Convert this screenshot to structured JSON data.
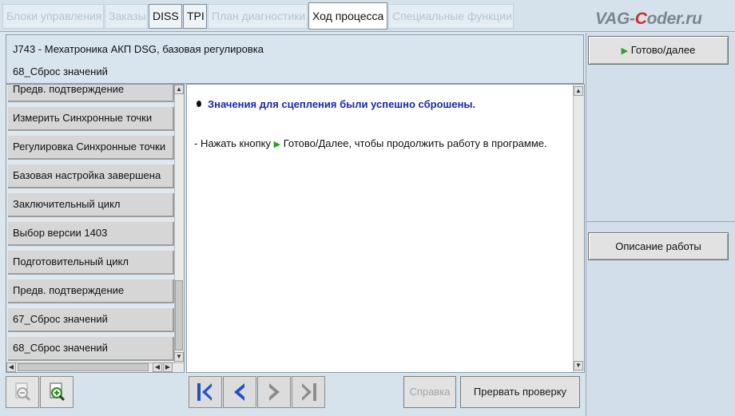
{
  "tabs": [
    {
      "label": "Блоки управления",
      "state": "disabled"
    },
    {
      "label": "Заказы",
      "state": "disabled"
    },
    {
      "label": "DISS",
      "state": "enabled"
    },
    {
      "label": "TPI",
      "state": "enabled"
    },
    {
      "label": "План диагностики",
      "state": "disabled"
    },
    {
      "label": "Ход процесса",
      "state": "active"
    },
    {
      "label": "Специальные функции",
      "state": "disabled"
    }
  ],
  "watermark": {
    "part1": "VAG-",
    "part2": "C",
    "part3": "oder.ru"
  },
  "header": {
    "line1": "J743 - Мехатроника АКП DSG, базовая регулировка",
    "line2": "68_Сброс значений"
  },
  "right_panel": {
    "done_button": "Готово/далее",
    "description_button": "Описание работы"
  },
  "steps": [
    "Предв. подтверждение",
    "Измерить Синхронные точки",
    "Регулировка Синхронные точки",
    "Базовая настройка завершена",
    "Заключительный цикл",
    "Выбор версии 1403",
    "Подготовительный цикл",
    "Предв. подтверждение",
    "67_Сброс значений",
    "68_Сброс значений"
  ],
  "content": {
    "title": "Значения для сцепления были успешно сброшены.",
    "body_prefix": "- Нажать кнопку ",
    "body_suffix": " Готово/Далее, чтобы продолжить работу в программе."
  },
  "bottom": {
    "help_button": "Справка",
    "abort_button": "Прервать проверку"
  },
  "colors": {
    "title_blue": "#1d27a8",
    "play_green": "#2aa02a",
    "nav_blue": "#1f52c8",
    "nav_grey": "#8c8c8c"
  }
}
